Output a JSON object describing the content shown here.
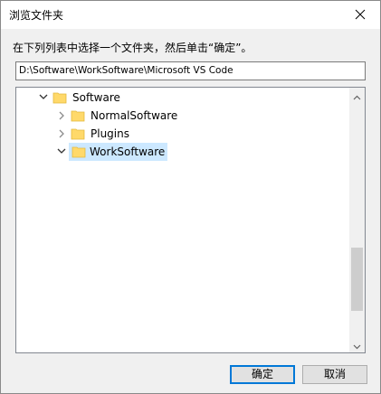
{
  "window": {
    "title": "浏览文件夹"
  },
  "instruction": "在下列列表中选择一个文件夹，然后单击“确定”。",
  "path": "D:\\Software\\WorkSoftware\\Microsoft VS Code",
  "tree": {
    "items": [
      {
        "label": "Software",
        "level": 0,
        "state": "expanded"
      },
      {
        "label": "NormalSoftware",
        "level": 1,
        "state": "collapsed"
      },
      {
        "label": "Plugins",
        "level": 1,
        "state": "collapsed"
      },
      {
        "label": "WorkSoftware",
        "level": 1,
        "state": "expanded",
        "selected": true
      }
    ]
  },
  "buttons": {
    "ok": "确定",
    "cancel": "取消"
  },
  "colors": {
    "accent": "#0078d7",
    "selection": "#cce8ff",
    "folder": "#ffd96a"
  },
  "icons": [
    "close-icon",
    "chevron-down-icon",
    "chevron-right-icon",
    "folder-icon",
    "scroll-up-arrow-icon",
    "scroll-down-arrow-icon"
  ]
}
